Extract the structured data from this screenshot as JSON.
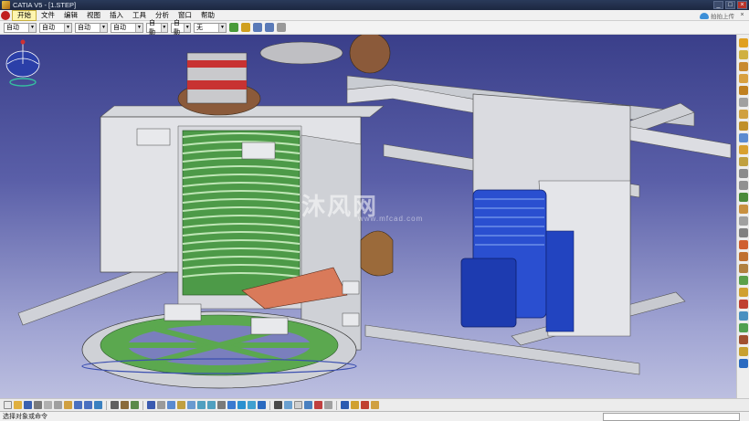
{
  "window": {
    "title": "CATIA V5 - [1.STEP]",
    "minimize_glyph": "_",
    "maximize_glyph": "□",
    "close_glyph": "×"
  },
  "menubar": {
    "items": [
      "开始",
      "文件",
      "编辑",
      "视图",
      "插入",
      "工具",
      "分析",
      "窗口",
      "帮助"
    ],
    "active_index": 0,
    "cloud_label": "拍拍上传",
    "close_glyph": "×"
  },
  "property_toolbar": {
    "combos": [
      {
        "value": "自动",
        "icon": "color-combo"
      },
      {
        "value": "自动",
        "icon": "transparency-combo"
      },
      {
        "value": "自动",
        "icon": "linetype-combo"
      },
      {
        "value": "自动",
        "icon": "lineweight-combo"
      },
      {
        "value": "自動",
        "icon": "point-combo"
      },
      {
        "value": "自動",
        "icon": "layer-combo"
      },
      {
        "value": "无",
        "icon": "rendering-combo"
      }
    ],
    "icons": [
      "painter-icon",
      "undo-icon",
      "redo-icon",
      "brush-icon",
      "eraser-icon"
    ]
  },
  "viewport": {
    "background_top": "#3a3f8a",
    "background_bottom": "#bcbfe0",
    "watermark_main": "沐风网",
    "watermark_sub": "www.mfcad.com"
  },
  "right_toolbar": {
    "icons": [
      "sketcher-icon",
      "pad-icon",
      "pocket-icon",
      "shaft-icon",
      "groove-icon",
      "hole-icon",
      "rib-icon",
      "slot-icon",
      "stiffener-icon",
      "loft-icon",
      "remove-loft-icon",
      "fillet-icon",
      "chamfer-icon",
      "draft-icon",
      "shell-icon",
      "thickness-icon",
      "thread-icon",
      "split-icon",
      "translate-icon",
      "rotate-icon",
      "symmetry-icon",
      "mirror-icon",
      "pattern-icon",
      "scaling-icon",
      "boolean-icon",
      "add-icon",
      "measure-icon",
      "apply-material-icon"
    ]
  },
  "bottom_toolbar": {
    "icons": [
      "new-icon",
      "open-icon",
      "save-icon",
      "print-icon",
      "cut-icon",
      "copy-icon",
      "paste-icon",
      "undo-icon",
      "redo-icon",
      "help-icon",
      "fx-icon",
      "knowledge-icon",
      "catalog-icon",
      "grid-icon",
      "compass-icon",
      "fit-all-icon",
      "pan-icon",
      "rotate-view-icon",
      "zoom-in-icon",
      "zoom-out-icon",
      "normal-view-icon",
      "iso-view-icon",
      "shading-icon",
      "hide-show-icon",
      "swap-icon",
      "snap-icon",
      "axis-icon",
      "plane-icon",
      "point-icon",
      "line-icon",
      "law-icon",
      "measure-between-icon",
      "measure-item-icon",
      "inertia-icon"
    ]
  },
  "statusbar": {
    "text": "选择对象或命令"
  },
  "compass": {
    "label": "compass-widget"
  }
}
